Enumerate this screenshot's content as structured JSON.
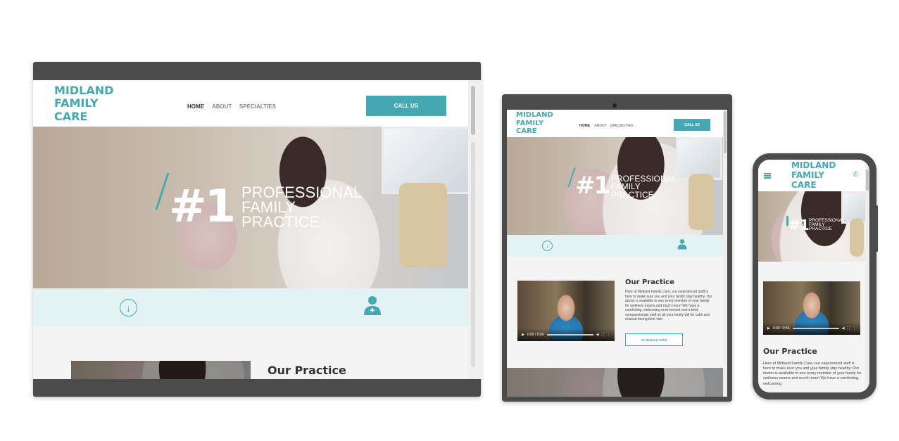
{
  "brand": {
    "line1": "MIDLAND",
    "line2": "FAMILY",
    "line3": "CARE"
  },
  "nav": {
    "home": "HOME",
    "about": "ABOUT",
    "specialties": "SPECIALTIES"
  },
  "cta": {
    "call": "CALL US"
  },
  "hero": {
    "number": "#1",
    "line1": "PROFESSIONAL",
    "line2": "FAMILY",
    "line3": "PRACTICE"
  },
  "practice": {
    "title": "Our Practice",
    "text": "Here at Midland Family Care, our experienced staff is here to make sure you and your family stay healthy. Our doctor is available to see every member of your family for wellness exams and much more! We have a comforting, welcoming environment and a kind, compassionate staff so all your family will be calm and relaxed during their visit.",
    "mobile_text": "Here at Midland Family Care, our experienced staff is here to make sure you and your family stay healthy. Our doctor is available to see every member of your family for wellness exams and much more! We have a comforting, welcoming",
    "button": "SCHEDULE NOW"
  },
  "video": {
    "time": "0:00 / 0:56",
    "time_short": "0:00 / 0:00"
  },
  "colors": {
    "accent": "#45a8b3",
    "band": "#e3f2f5",
    "frame": "#4b4b4b"
  },
  "icons": {
    "arrow": "arrow-down-circle-icon",
    "doctor": "doctor-icon",
    "menu": "hamburger-menu-icon",
    "phone": "phone-icon"
  }
}
